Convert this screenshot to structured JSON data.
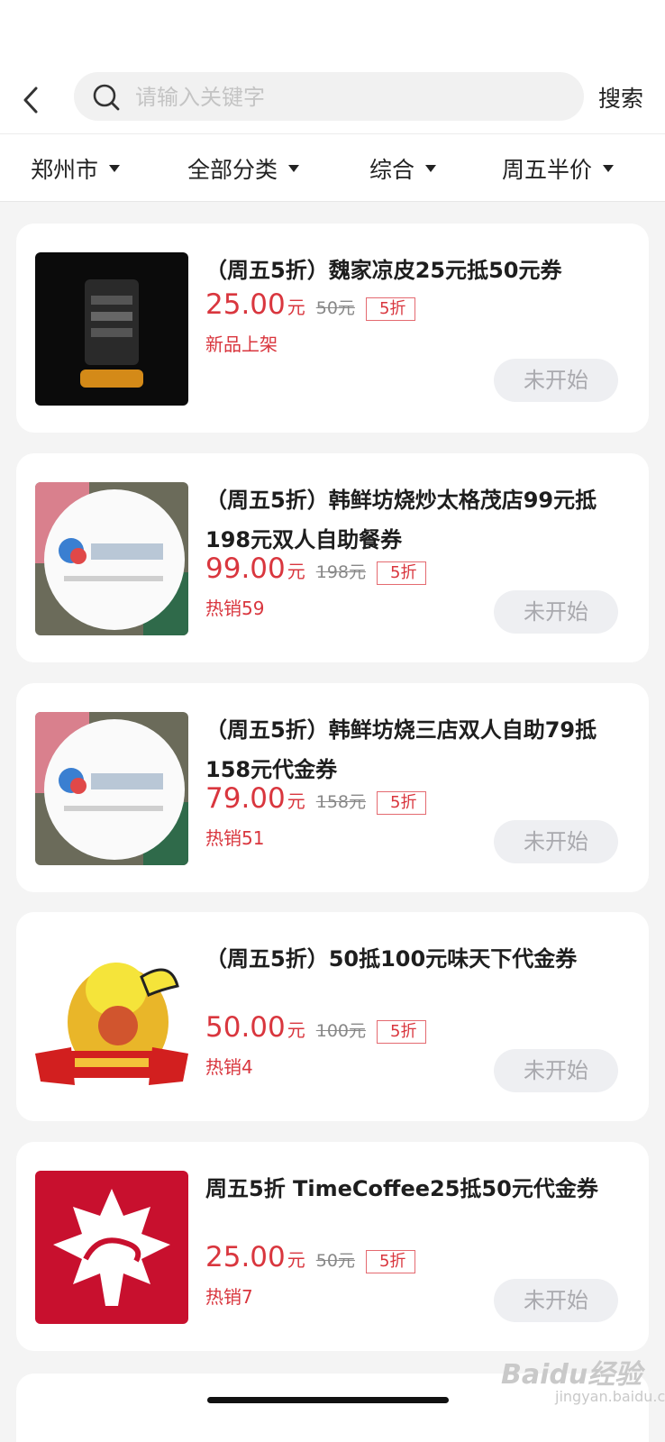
{
  "search": {
    "placeholder": "请输入关键字",
    "button_label": "搜索"
  },
  "filters": [
    {
      "label": "郑州市"
    },
    {
      "label": "全部分类"
    },
    {
      "label": "综合"
    },
    {
      "label": "周五半价"
    }
  ],
  "deals": [
    {
      "title": "（周五5折）魏家凉皮25元抵50元券",
      "price": "25.00",
      "unit": "元",
      "original": "50元",
      "discount": "5折",
      "sub": "新品上架",
      "button": "未开始"
    },
    {
      "title": "（周五5折）韩鲜坊烧炒太格茂店99元抵198元双人自助餐券",
      "price": "99.00",
      "unit": "元",
      "original": "198元",
      "discount": "5折",
      "sub": "热销59",
      "button": "未开始"
    },
    {
      "title": "（周五5折）韩鲜坊烧三店双人自助79抵158元代金券",
      "price": "79.00",
      "unit": "元",
      "original": "158元",
      "discount": "5折",
      "sub": "热销51",
      "button": "未开始"
    },
    {
      "title": "（周五5折）50抵100元味天下代金券",
      "price": "50.00",
      "unit": "元",
      "original": "100元",
      "discount": "5折",
      "sub": "热销4",
      "button": "未开始"
    },
    {
      "title": "周五5折 TimeCoffee25抵50元代金券",
      "price": "25.00",
      "unit": "元",
      "original": "50元",
      "discount": "5折",
      "sub": "热销7",
      "button": "未开始"
    }
  ],
  "watermark": {
    "text": "Baidu经验",
    "sub": "jingyan.baidu.com"
  }
}
